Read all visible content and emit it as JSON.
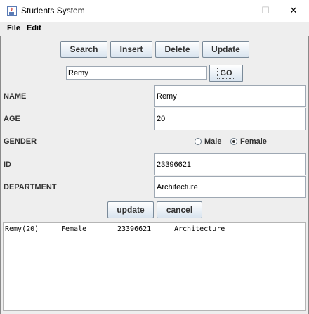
{
  "window": {
    "title": "Students System",
    "controls": {
      "minimize": "—",
      "maximize": "☐",
      "close": "✕"
    }
  },
  "menu": {
    "file": "File",
    "edit": "Edit"
  },
  "actions": {
    "search": "Search",
    "insert": "Insert",
    "delete": "Delete",
    "update": "Update"
  },
  "search": {
    "value": "Remy",
    "go": "GO"
  },
  "form": {
    "name_label": "NAME",
    "name_value": "Remy",
    "age_label": "AGE",
    "age_value": "20",
    "gender_label": "GENDER",
    "gender_male": "Male",
    "gender_female": "Female",
    "gender_selected": "Female",
    "id_label": "ID",
    "id_value": "23396621",
    "department_label": "DEPARTMENT",
    "department_value": "Architecture"
  },
  "form_buttons": {
    "update": "update",
    "cancel": "cancel"
  },
  "results": {
    "rows": [
      {
        "name_age": "Remy(20)",
        "gender": "Female",
        "id": "23396621",
        "department": "Architecture"
      }
    ]
  },
  "colors": {
    "background": "#eeeeee",
    "field_border": "#9ea8b3",
    "button_gradient_bottom": "#d9e4ef"
  }
}
